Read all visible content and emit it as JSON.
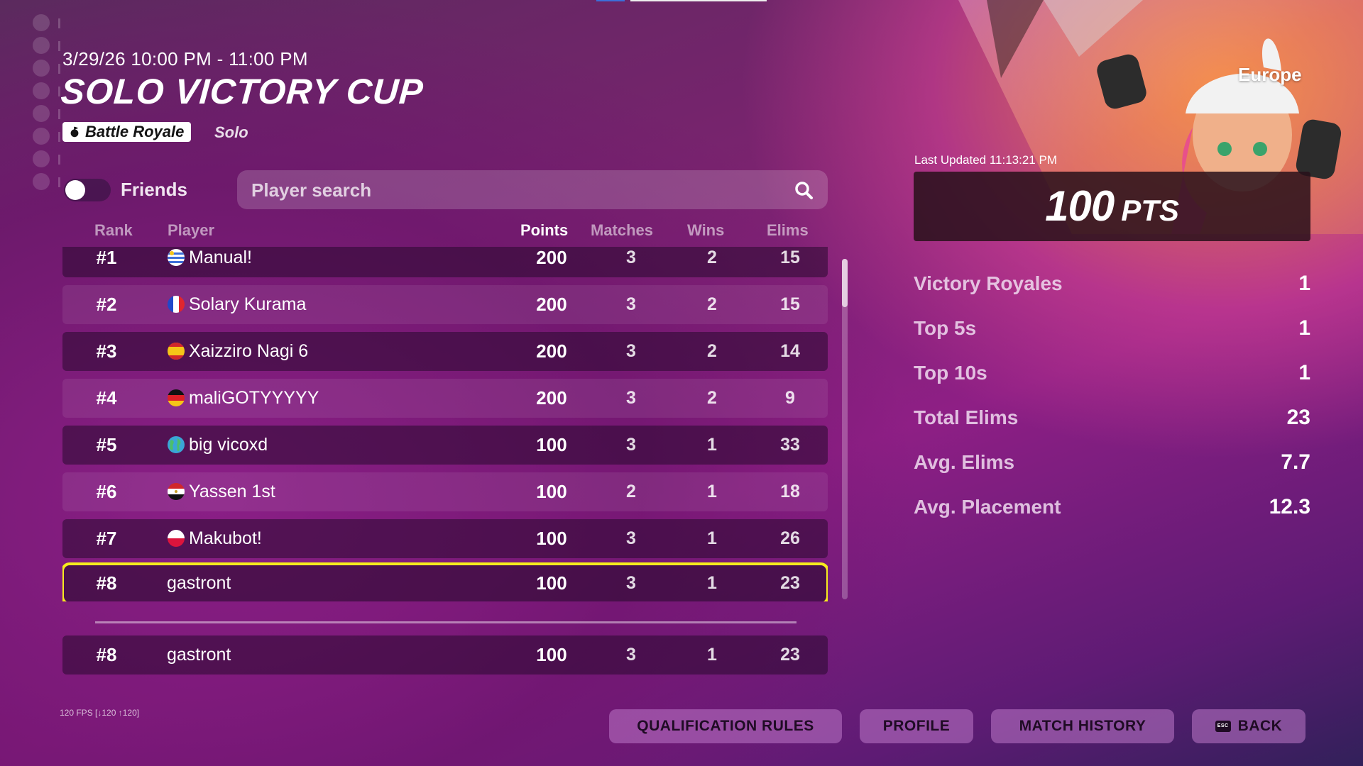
{
  "event": {
    "timeframe": "3/29/26 10:00 PM - 11:00 PM",
    "title": "SOLO VICTORY CUP",
    "mode": "Battle Royale",
    "submode": "Solo"
  },
  "filters": {
    "friends_label": "Friends",
    "friends_toggle_on": false,
    "search_placeholder": "Player search",
    "search_icon": "magnifier-icon"
  },
  "table": {
    "headers": {
      "rank": "Rank",
      "player": "Player",
      "points": "Points",
      "matches": "Matches",
      "wins": "Wins",
      "elims": "Elims"
    },
    "rows": [
      {
        "rank": "#1",
        "player": "Manual!",
        "flag": "uruguay-flag-icon",
        "points": "200",
        "matches": "3",
        "wins": "2",
        "elims": "15"
      },
      {
        "rank": "#2",
        "player": "Solary Kurama",
        "flag": "france-flag-icon",
        "points": "200",
        "matches": "3",
        "wins": "2",
        "elims": "15"
      },
      {
        "rank": "#3",
        "player": "Xaizziro Nagi 6",
        "flag": "spain-flag-icon",
        "points": "200",
        "matches": "3",
        "wins": "2",
        "elims": "14"
      },
      {
        "rank": "#4",
        "player": "maliGOTYYYYY",
        "flag": "germany-flag-icon",
        "points": "200",
        "matches": "3",
        "wins": "2",
        "elims": "9"
      },
      {
        "rank": "#5",
        "player": "big vicoxd",
        "flag": "globe-icon",
        "points": "100",
        "matches": "3",
        "wins": "1",
        "elims": "33"
      },
      {
        "rank": "#6",
        "player": "Yassen 1st",
        "flag": "egypt-flag-icon",
        "points": "100",
        "matches": "2",
        "wins": "1",
        "elims": "18"
      },
      {
        "rank": "#7",
        "player": "Makubot!",
        "flag": "poland-flag-icon",
        "points": "100",
        "matches": "3",
        "wins": "1",
        "elims": "26"
      },
      {
        "rank": "#8",
        "player": "gastront",
        "flag": "",
        "points": "100",
        "matches": "3",
        "wins": "1",
        "elims": "23"
      }
    ],
    "selected_rank": "#8"
  },
  "my_row": {
    "rank": "#8",
    "player": "gastront",
    "points": "100",
    "matches": "3",
    "wins": "1",
    "elims": "23"
  },
  "fps": "120 FPS [↓120 ↑120]",
  "summary": {
    "region": "Europe",
    "last_updated": "Last Updated 11:13:21 PM",
    "points": "100",
    "points_unit": "PTS",
    "stats": [
      {
        "label": "Victory Royales",
        "value": "1"
      },
      {
        "label": "Top 5s",
        "value": "1"
      },
      {
        "label": "Top 10s",
        "value": "1"
      },
      {
        "label": "Total Elims",
        "value": "23"
      },
      {
        "label": "Avg. Elims",
        "value": "7.7"
      },
      {
        "label": "Avg. Placement",
        "value": "12.3"
      }
    ]
  },
  "buttons": {
    "qualification_rules": "QUALIFICATION RULES",
    "profile": "PROFILE",
    "match_history": "MATCH HISTORY",
    "back": "BACK",
    "esc_key": "ESC"
  },
  "colors": {
    "selection_outline": "#f7ec1d",
    "button_bg": "#be78c8"
  }
}
